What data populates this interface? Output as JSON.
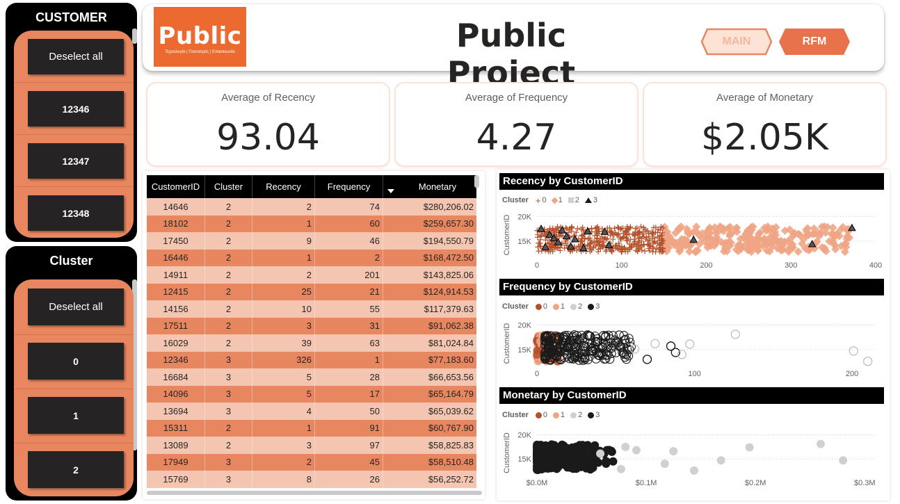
{
  "header": {
    "logo_text": "Public",
    "logo_subtext": "Τεχνολογία | Πολιτισμός | Επικοινωνία",
    "title": "Public Project",
    "nav_main": "MAIN",
    "nav_rfm": "RFM"
  },
  "customer_slicer": {
    "title": "CUSTOMER",
    "items": [
      "Deselect all",
      "12346",
      "12347",
      "12348"
    ]
  },
  "cluster_slicer": {
    "title": "Cluster",
    "items": [
      "Deselect all",
      "0",
      "1",
      "2"
    ]
  },
  "kpis": [
    {
      "label": "Average of Recency",
      "value": "93.04"
    },
    {
      "label": "Average of Frequency",
      "value": "4.27"
    },
    {
      "label": "Average of Monetary",
      "value": "$2.05K"
    }
  ],
  "table": {
    "columns": [
      "CustomerID",
      "Cluster",
      "Recency",
      "Frequency",
      "Monetary"
    ],
    "rows": [
      [
        "14646",
        "2",
        "2",
        "74",
        "$280,206.02"
      ],
      [
        "18102",
        "2",
        "1",
        "60",
        "$259,657.30"
      ],
      [
        "17450",
        "2",
        "9",
        "46",
        "$194,550.79"
      ],
      [
        "16446",
        "2",
        "1",
        "2",
        "$168,472.50"
      ],
      [
        "14911",
        "2",
        "2",
        "201",
        "$143,825.06"
      ],
      [
        "12415",
        "2",
        "25",
        "21",
        "$124,914.53"
      ],
      [
        "14156",
        "2",
        "10",
        "55",
        "$117,379.63"
      ],
      [
        "17511",
        "2",
        "3",
        "31",
        "$91,062.38"
      ],
      [
        "16029",
        "2",
        "39",
        "63",
        "$81,024.84"
      ],
      [
        "12346",
        "3",
        "326",
        "1",
        "$77,183.60"
      ],
      [
        "16684",
        "3",
        "5",
        "28",
        "$66,653.56"
      ],
      [
        "14096",
        "3",
        "5",
        "17",
        "$65,164.79"
      ],
      [
        "13694",
        "3",
        "4",
        "50",
        "$65,039.62"
      ],
      [
        "15311",
        "2",
        "1",
        "91",
        "$60,767.90"
      ],
      [
        "13089",
        "2",
        "3",
        "97",
        "$58,825.83"
      ],
      [
        "17949",
        "3",
        "2",
        "45",
        "$58,510.48"
      ],
      [
        "15769",
        "3",
        "8",
        "26",
        "$56,252.72"
      ]
    ]
  },
  "colors": {
    "accent": "#e8875f",
    "row_dark": "#e8875f",
    "row_light": "#f4c6b1",
    "cluster0": "#b4502a",
    "cluster1": "#f0a585",
    "cluster2": "#d0d0d0",
    "cluster3": "#1a1a1a"
  },
  "chart_data": [
    {
      "type": "scatter",
      "title": "Recency by CustomerID",
      "legend_title": "Cluster",
      "legend": [
        "0",
        "1",
        "2",
        "3"
      ],
      "markers": [
        "plus",
        "diamond",
        "square",
        "triangle"
      ],
      "xlabel": "",
      "ylabel": "CustomerID",
      "xticks": [
        "0",
        "100",
        "200",
        "300",
        "400"
      ],
      "yticks": [
        "15K",
        "20K"
      ],
      "xlim": [
        0,
        400
      ],
      "ylim": [
        12000,
        20500
      ],
      "series": [
        {
          "name": "0",
          "x_range": [
            0,
            150
          ],
          "density": "dense"
        },
        {
          "name": "1",
          "x_range": [
            150,
            375
          ],
          "density": "dense"
        },
        {
          "name": "2",
          "x": [
            40
          ],
          "y": [
            15100
          ]
        },
        {
          "name": "3",
          "x": [
            5,
            10,
            15,
            20,
            25,
            30,
            35,
            40,
            45,
            55,
            60,
            80,
            85,
            185,
            325,
            372
          ],
          "y": [
            17500,
            13800,
            16300,
            15600,
            14800,
            17200,
            16000,
            13900,
            15400,
            13600,
            17000,
            16900,
            14200,
            15300,
            14400,
            17700
          ]
        }
      ]
    },
    {
      "type": "scatter",
      "title": "Frequency by CustomerID",
      "legend_title": "Cluster",
      "legend": [
        "0",
        "1",
        "2",
        "3"
      ],
      "markers": [
        "circle",
        "circle",
        "circle",
        "circle"
      ],
      "xlabel": "",
      "ylabel": "CustomerID",
      "xticks": [
        "0",
        "100",
        "200"
      ],
      "yticks": [
        "15K",
        "20K"
      ],
      "xlim": [
        0,
        215
      ],
      "ylim": [
        12000,
        20500
      ],
      "series": [
        {
          "name": "0",
          "x_range": [
            0,
            15
          ],
          "density": "dense"
        },
        {
          "name": "2",
          "x": [
            62,
            75,
            92,
            97,
            126,
            201,
            210
          ],
          "y": [
            15100,
            16200,
            14000,
            16100,
            18100,
            14700,
            12600
          ]
        },
        {
          "name": "3",
          "x_range": [
            5,
            60
          ],
          "density": "dense",
          "x": [
            70,
            85,
            88
          ],
          "y": [
            13000,
            15700,
            14400
          ]
        }
      ]
    },
    {
      "type": "scatter",
      "title": "Monetary by CustomerID",
      "legend_title": "Cluster",
      "legend": [
        "0",
        "1",
        "2",
        "3"
      ],
      "markers": [
        "circle",
        "circle",
        "circle",
        "circle"
      ],
      "xlabel": "",
      "ylabel": "CustomerID",
      "xticks": [
        "$0.0M",
        "$0.1M",
        "$0.2M",
        "$0.3M"
      ],
      "yticks": [
        "15K",
        "20K"
      ],
      "xlim": [
        0,
        310000
      ],
      "ylim": [
        12000,
        20500
      ],
      "series": [
        {
          "name": "0",
          "x_range": [
            0,
            30000
          ],
          "density": "dense"
        },
        {
          "name": "2",
          "x": [
            58000,
            77000,
            81000,
            91000,
            117000,
            124914,
            143825,
            168472,
            194550,
            259657,
            280206
          ],
          "y": [
            16100,
            12900,
            17500,
            16800,
            14000,
            16600,
            12600,
            14700,
            17400,
            18100,
            14700
          ]
        },
        {
          "name": "3",
          "x_range": [
            5000,
            70000
          ],
          "density": "dense"
        }
      ]
    }
  ]
}
